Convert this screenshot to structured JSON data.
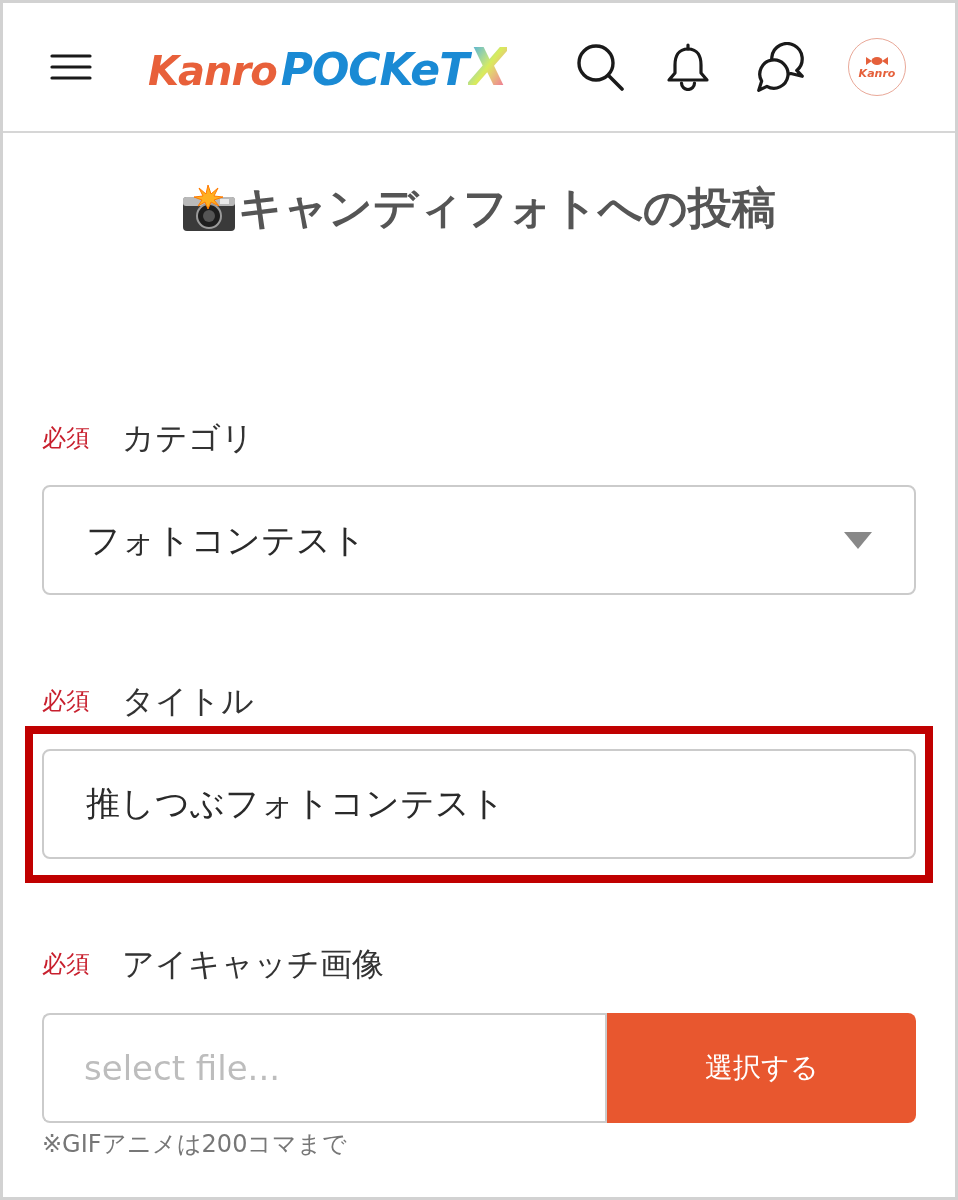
{
  "header": {
    "logo": {
      "brand": "Kanro",
      "product": "POCKeT",
      "mark": "X"
    },
    "avatar": {
      "label": "Kanro"
    }
  },
  "page_title": "キャンディフォトへの投稿",
  "fields": [
    {
      "kind": "select",
      "required_tag": "必須",
      "label": "カテゴリ",
      "value": "フォトコンテスト",
      "highlighted": false
    },
    {
      "kind": "text",
      "required_tag": "必須",
      "label": "タイトル",
      "value": "推しつぶフォトコンテスト",
      "highlighted": true
    },
    {
      "kind": "file",
      "required_tag": "必須",
      "label": "アイキャッチ画像",
      "placeholder": "select file...",
      "button": "選択する",
      "note": "※GIFアニメは200コマまで",
      "highlighted": false
    }
  ]
}
